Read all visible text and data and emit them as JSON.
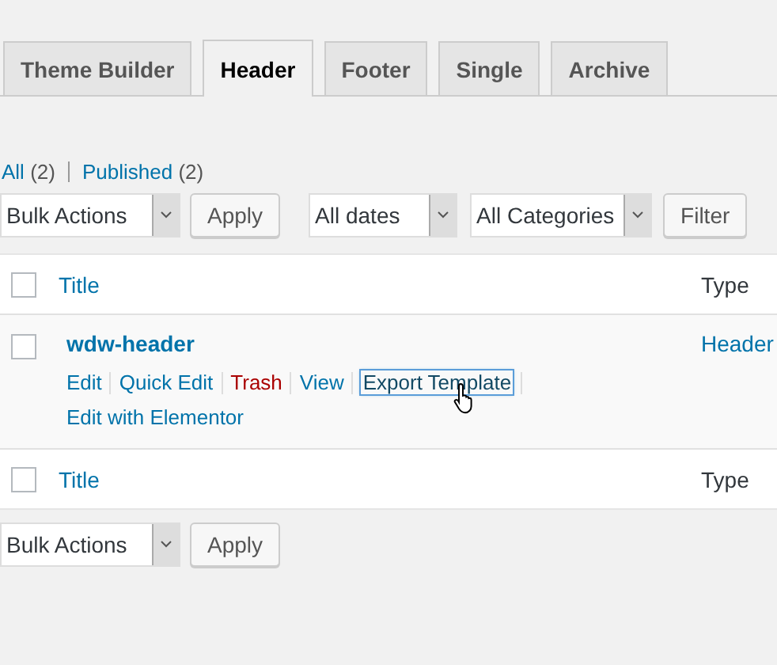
{
  "tabs": [
    {
      "label": "Theme Builder",
      "selected": false
    },
    {
      "label": "Header",
      "selected": true
    },
    {
      "label": "Footer",
      "selected": false
    },
    {
      "label": "Single",
      "selected": false
    },
    {
      "label": "Archive",
      "selected": false
    }
  ],
  "filter_links": [
    {
      "label": "All",
      "count": "(2)",
      "selected": false
    },
    {
      "label": "Published",
      "count": "(2)",
      "selected": false
    }
  ],
  "top_actions": {
    "bulk_select": "Bulk Actions",
    "apply": "Apply",
    "date_select": "All dates",
    "category_select": "All Categories",
    "filter": "Filter"
  },
  "table": {
    "header": {
      "title": "Title",
      "type": "Type",
      "checked": false
    },
    "rows": [
      {
        "title": "wdw-header",
        "type": "Header",
        "checked": false,
        "actions": [
          {
            "label": "Edit",
            "kind": "link"
          },
          {
            "label": "Quick Edit",
            "kind": "link"
          },
          {
            "label": "Trash",
            "kind": "danger"
          },
          {
            "label": "View",
            "kind": "link"
          },
          {
            "label": "Export Template",
            "kind": "focused"
          },
          {
            "label": "Edit with Elementor",
            "kind": "link"
          }
        ]
      }
    ],
    "footer": {
      "title": "Title",
      "type": "Type",
      "checked": false
    }
  },
  "bottom_actions": {
    "bulk_select": "Bulk Actions",
    "apply": "Apply"
  }
}
